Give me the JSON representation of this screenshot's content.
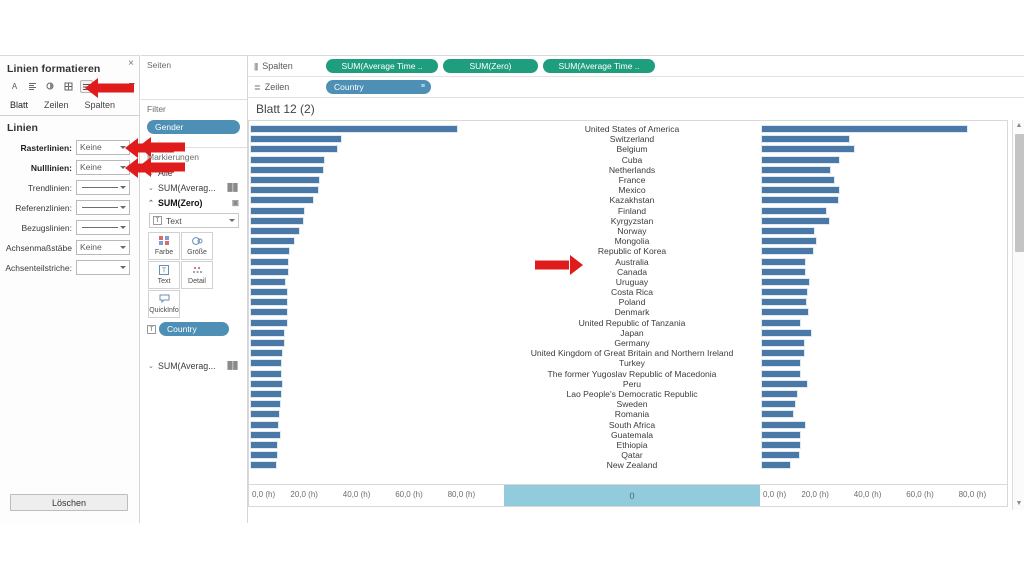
{
  "format_pane": {
    "title": "Linien formatieren",
    "close_label": "×",
    "toolbar_icons": [
      "font-icon",
      "alignment-icon",
      "shading-icon",
      "borders-icon",
      "lines-icon"
    ],
    "tabs": [
      {
        "label": "Blatt",
        "active": true
      },
      {
        "label": "Zeilen",
        "active": false
      },
      {
        "label": "Spalten",
        "active": false
      }
    ],
    "section_title": "Linien",
    "rows": [
      {
        "label": "Rasterlinien:",
        "value": "Keine",
        "bold": true,
        "type": "text"
      },
      {
        "label": "Nulllinien:",
        "value": "Keine",
        "bold": true,
        "type": "text"
      },
      {
        "label": "Trendlinien:",
        "value": "",
        "bold": false,
        "type": "line"
      },
      {
        "label": "Referenzlinien:",
        "value": "",
        "bold": false,
        "type": "line"
      },
      {
        "label": "Bezugslinien:",
        "value": "",
        "bold": false,
        "type": "line"
      },
      {
        "label": "Achsenmaßstäbe",
        "value": "Keine",
        "bold": false,
        "type": "text"
      },
      {
        "label": "Achsenteilstriche:",
        "value": "",
        "bold": false,
        "type": "empty"
      }
    ],
    "delete_button": "Löschen"
  },
  "cards_pane": {
    "pages_heading": "Seiten",
    "filter_heading": "Filter",
    "filter_pill": "Gender",
    "marks_heading": "Markierungen",
    "marks_rows": [
      {
        "label": "Alle",
        "bold": false,
        "chevron": "⌄",
        "right_icon": ""
      },
      {
        "label": "SUM(Averag...",
        "bold": false,
        "chevron": "⌄",
        "right_icon": "▐█"
      },
      {
        "label": "SUM(Zero)",
        "bold": true,
        "chevron": "⌃",
        "right_icon": "T"
      }
    ],
    "mark_type": "Text",
    "mark_buttons": [
      {
        "label": "Farbe",
        "icon": "color-icon"
      },
      {
        "label": "Größe",
        "icon": "size-icon"
      },
      {
        "label": "Text",
        "icon": "text-icon"
      },
      {
        "label": "Detail",
        "icon": "detail-icon"
      },
      {
        "label": "QuickInfo",
        "icon": "tooltip-icon"
      }
    ],
    "mark_pill": "Country",
    "marks_row_bottom": {
      "label": "SUM(Averag...",
      "chevron": "⌄",
      "right_icon": "▐█"
    }
  },
  "shelves": {
    "columns_label": "Spalten",
    "rows_label": "Zeilen",
    "columns_pills": [
      "SUM(Average Time ..",
      "SUM(Zero)",
      "SUM(Average Time .."
    ],
    "rows_pills": [
      "Country"
    ]
  },
  "viz": {
    "sheet_title": "Blatt 12 (2)",
    "center_axis_value": "0"
  },
  "chart_data": {
    "type": "bar",
    "title": "Blatt 12 (2)",
    "xlabel": "",
    "ylabel": "Country",
    "xlim": [
      0,
      90
    ],
    "grid": false,
    "legend": "none",
    "orientation": "horizontal-butterfly",
    "tick_labels": [
      "0,0 (h)",
      "20,0 (h)",
      "40,0 (h)",
      "60,0 (h)",
      "80,0 (h)"
    ],
    "tick_values": [
      0,
      20,
      40,
      60,
      80
    ],
    "categories": [
      "United States of America",
      "Switzerland",
      "Belgium",
      "Cuba",
      "Netherlands",
      "France",
      "Mexico",
      "Kazakhstan",
      "Finland",
      "Kyrgyzstan",
      "Norway",
      "Mongolia",
      "Republic of Korea",
      "Australia",
      "Canada",
      "Uruguay",
      "Costa Rica",
      "Poland",
      "Denmark",
      "United Republic of Tanzania",
      "Japan",
      "Germany",
      "United Kingdom of Great Britain and Northern Ireland",
      "Turkey",
      "The former Yugoslav Republic of Macedonia",
      "Peru",
      "Lao People's Democratic Republic",
      "Sweden",
      "Romania",
      "South Africa",
      "Guatemala",
      "Ethiopia",
      "Qatar",
      "New Zealand"
    ],
    "series": [
      {
        "name": "SUM(Average Time .. ) left",
        "values": [
          79.5,
          35.0,
          33.6,
          28.8,
          28.4,
          26.8,
          26.5,
          24.5,
          21.0,
          20.6,
          19.2,
          17.0,
          15.3,
          15.0,
          14.9,
          13.9,
          14.4,
          14.6,
          14.5,
          14.5,
          13.5,
          13.4,
          12.7,
          12.4,
          12.4,
          12.7,
          12.1,
          11.9,
          11.3,
          11.2,
          11.7,
          10.7,
          10.5,
          10.4
        ]
      },
      {
        "name": "SUM(Average Time .. ) right",
        "values": [
          79.0,
          34.0,
          35.8,
          30.2,
          26.7,
          28.3,
          30.2,
          29.6,
          25.0,
          26.4,
          20.5,
          21.2,
          20.2,
          17.1,
          17.1,
          18.7,
          17.9,
          17.5,
          18.5,
          15.3,
          19.6,
          16.8,
          16.9,
          15.4,
          15.2,
          17.9,
          14.0,
          13.4,
          12.7,
          17.3,
          15.4,
          15.1,
          14.9,
          11.5
        ]
      }
    ],
    "annotations": [
      {
        "type": "arrow",
        "color": "#e01b1b",
        "target": "Republic of Korea"
      },
      {
        "type": "arrow",
        "color": "#e01b1b",
        "target": "Rasterlinien"
      },
      {
        "type": "arrow",
        "color": "#e01b1b",
        "target": "Nulllinien"
      },
      {
        "type": "arrow",
        "color": "#e01b1b",
        "target": "lines-format-toolbar-button"
      },
      {
        "type": "arrow",
        "color": "#e01b1b",
        "target": "Filter-Gender"
      },
      {
        "type": "arrow",
        "color": "#e01b1b",
        "target": "Markierungen"
      }
    ]
  }
}
